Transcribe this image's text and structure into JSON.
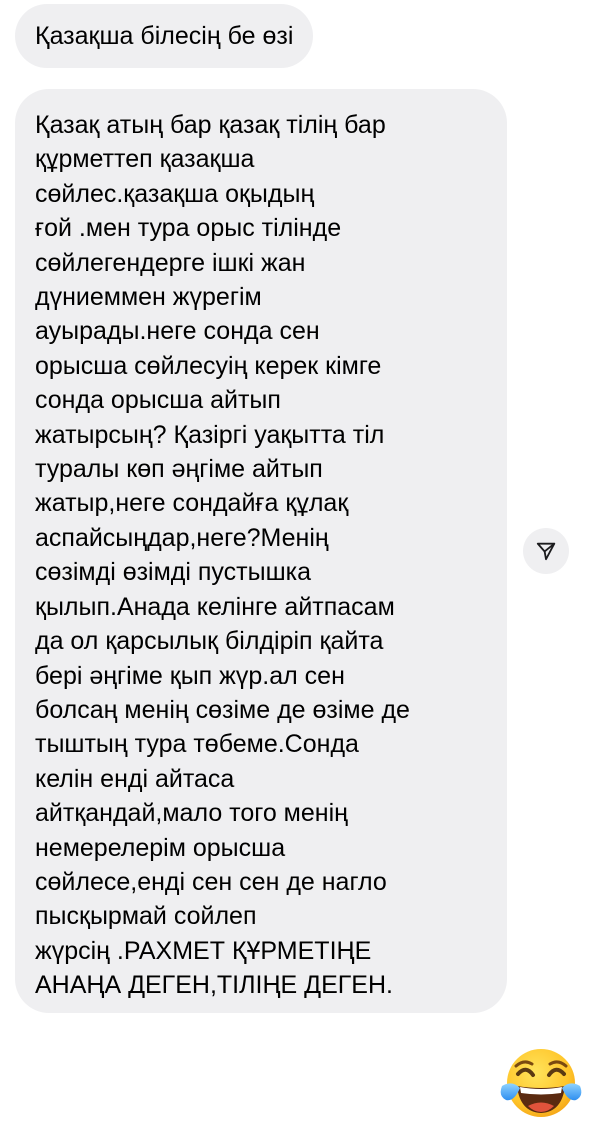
{
  "messages": [
    {
      "text": "Қазақша білесің бе өзі"
    },
    {
      "text": "Қазақ атың бар қазақ тілің бар\nқұрметтеп қазақша\nсөйлес.қазақша оқыдың\nғой .мен тура орыс тілінде\nсөйлегендерге ішкі жан\nдүниеммен жүрегім\nауырады.неге сонда сен\nорысша сөйлесуің керек кімге\nсонда орысша айтып\nжатырсың? Қазіргі уақытта тіл\nтуралы көп әңгіме айтып\nжатыр,неге сондайға құлақ\nаспайсыңдар,неге?Менің\nсөзімді өзімді пустышка\nқылып.Анада келінге айтпасам\nда ол қарсылық білдіріп қайта\nбері әңгіме қып жүр.ал сен\nболсаң менің сөзіме де өзіме де\nтыштың тура төбеме.Сонда\nкелін енді айтаса\nайтқандай,мало того менің\nнемерелерім орысша\nсөйлесе,енді сен сен де нагло\nпысқырмай сойлеп\nжүрсің .РАХМЕТ ҚҰРМЕТІҢЕ\nАНАҢА ДЕГЕН,ТІЛІҢЕ ДЕГЕН."
    }
  ],
  "share_icon": "paper-plane-icon",
  "reaction_icon": "tears-of-joy-emoji-icon",
  "colors": {
    "bubble": "#efeff1",
    "text": "#000000",
    "background": "#ffffff"
  }
}
